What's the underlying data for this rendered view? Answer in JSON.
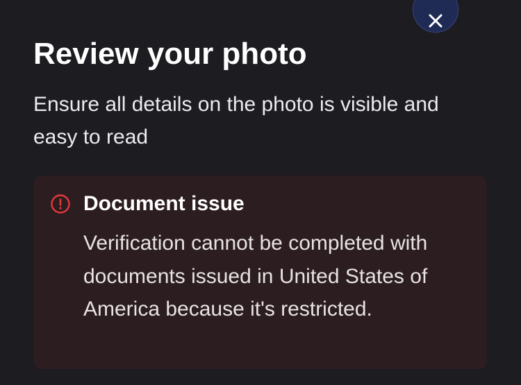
{
  "dialog": {
    "close_icon": "close-icon",
    "title": "Review your photo",
    "subtitle": "Ensure all details on the photo is visible and easy to read"
  },
  "alert": {
    "icon": "error-circle-icon",
    "title": "Document issue",
    "message": "Verification cannot be completed with documents issued in United States of America because it's restricted."
  },
  "colors": {
    "background": "#1c1c21",
    "close_button_bg": "#1f2a55",
    "alert_bg": "#2c1d20",
    "alert_icon": "#e5393a"
  }
}
